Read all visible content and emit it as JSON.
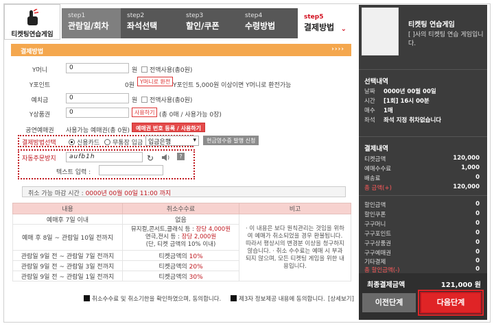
{
  "app": {
    "logo_text": "티켓팅연습게임"
  },
  "steps": [
    {
      "num": "step1",
      "label": "관람일/회차"
    },
    {
      "num": "step2",
      "label": "좌석선택"
    },
    {
      "num": "step3",
      "label": "할인/쿠폰"
    },
    {
      "num": "step4",
      "label": "수령방법"
    },
    {
      "num": "step5",
      "label": "결제방법"
    }
  ],
  "section_title": "결제방법",
  "section_arrows": "››››",
  "form": {
    "ymoney_label": "Y머니",
    "ymoney_value": "0",
    "won1": "원",
    "ymoney_all": "전액사용(총0원)",
    "ypoint_label": "Y포인트",
    "ypoint_value": "0원",
    "ypoint_btn": "Y머니로 환전",
    "ypoint_note": "Y포인트 5,000원 이상이면 Y머니로 환전가능",
    "deposit_label": "예치금",
    "deposit_value": "0",
    "won2": "원",
    "deposit_all": "전액사용(총0원)",
    "gift_label": "Y상품권",
    "gift_value": "0",
    "gift_btn": "사용하기",
    "gift_note": "(총 0매 / 사용가능 0장)",
    "voucher_label": "공연예매권",
    "voucher_note": "사용가능 예매권(총 0원)",
    "voucher_btn": "예매권 번호 등록 / 사용하기",
    "paymethod_label": "결제방법선택",
    "pay_card": "신용카드",
    "pay_bank": "무통장 입금",
    "bank_select": "입금은행",
    "receipt_btn": "현금영수증 발행 신청",
    "captcha_label": "자동주문방지",
    "captcha_value": "aufb1h",
    "captcha_input_label": "텍스트 입력 :"
  },
  "deadline": {
    "prefix": "취소 가능 마감 시간 : ",
    "value": "0000년 00월 00일 11:00 까지"
  },
  "fees": {
    "headers": [
      "내용",
      "취소수수료",
      "비고"
    ],
    "rows": [
      {
        "content": "예매후 7일 이내",
        "fee": "없음",
        "fee_red": ""
      },
      {
        "content": "예매 후 8일 ~ 관람일 10일 전까지",
        "fee": "뮤지컬,콘서트,클래식 등 : ",
        "fee_red": "장당 4,000원",
        "fee2": "연극,전시 등 : ",
        "fee2_red": "장당 2,000원",
        "fee3": "(단, 티켓 금액의 10% 이내)"
      },
      {
        "content": "관람일 9일 전 ~ 관람일 7일 전까지",
        "fee": "티켓금액의 ",
        "fee_red": "10%"
      },
      {
        "content": "관람일 9일 전 ~ 관람일 3일 전까지",
        "fee": "티켓금액의 ",
        "fee_red": "20%"
      },
      {
        "content": "관람일 9일 전 ~ 관람일 1일 전까지",
        "fee": "티켓금액의 ",
        "fee_red": "30%"
      }
    ],
    "note": "· 이 내용은 보다 원칙관리는 것임을 위하여 예매가 취소되었을 경우 환불됩니다. 따라서 평상시의 변경분 이상을 청구하지 않습니다. · 취소 수수료는 예매 시 부과되지 않으며, 모든 티켓팅 게임을 위한 내용입니다."
  },
  "agree": {
    "a1": "취소수수료 및 취소기한을 확인하였으며, 동의합니다.",
    "a2": "제3자 정보제공 내용에 동의합니다.",
    "a2_link": "[상세보기]"
  },
  "sidebar": {
    "title": "티켓팅 연습게임",
    "desc": "[ ]사의 티켓팅 연습 게임입니다.",
    "sel_title": "선택내역",
    "sel": [
      {
        "k": "날짜",
        "v": "0000년 00월 00일"
      },
      {
        "k": "시간",
        "v": "[1회] 16시 00분"
      },
      {
        "k": "매수",
        "v": "1매"
      },
      {
        "k": "좌석",
        "v": "좌석 지정 취차없습니다"
      }
    ],
    "pay_title": "결제내역",
    "pay": [
      {
        "k": "티켓금액",
        "v": "120,000"
      },
      {
        "k": "예매수수료",
        "v": "1,000"
      },
      {
        "k": "배송료",
        "v": "0"
      },
      {
        "k": "총 금액(+)",
        "v": "120,000"
      }
    ],
    "disc": [
      {
        "k": "할인금액",
        "v": "0"
      },
      {
        "k": "할인쿠폰",
        "v": "0"
      },
      {
        "k": "구구머니",
        "v": "0"
      },
      {
        "k": "구구포인트",
        "v": "0"
      },
      {
        "k": "구구상품권",
        "v": "0"
      },
      {
        "k": "구구예매권",
        "v": "0"
      },
      {
        "k": "기타결제",
        "v": "0"
      },
      {
        "k": "총 할인금액(-)",
        "v": "0"
      }
    ],
    "final_label": "최종결제금액",
    "final_value": "121,000 원",
    "prev_btn": "이전단계",
    "next_btn": "다음단계"
  },
  "colors": {
    "accent": "#f4a74e",
    "brand_red": "#e02426",
    "sidebar_bg": "#3c3c3c"
  }
}
